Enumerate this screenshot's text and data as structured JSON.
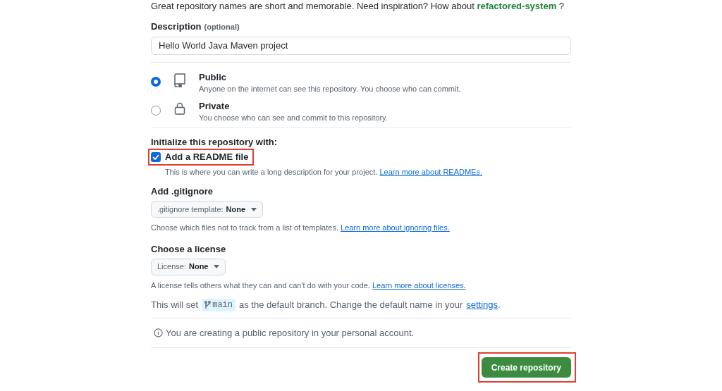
{
  "name_hint": {
    "text": "Great repository names are short and memorable. Need inspiration? How about",
    "suggestion": "refactored-system",
    "after": "?"
  },
  "description": {
    "label": "Description",
    "optional": "(optional)",
    "value": "Hello World Java Maven project"
  },
  "visibility": [
    {
      "kind": "repo",
      "label": "Public",
      "note": "Anyone on the internet can see this repository. You choose who can commit.",
      "selected": true
    },
    {
      "kind": "lock",
      "label": "Private",
      "note": "You choose who can see and commit to this repository.",
      "selected": false
    }
  ],
  "initialize": {
    "heading": "Initialize this repository with:",
    "readme": {
      "label": "Add a README file",
      "note": "This is where you can write a long description for your project.",
      "link": "Learn more about READMEs.",
      "checked": true,
      "highlighted": true
    }
  },
  "gitignore": {
    "heading": "Add .gitignore",
    "prefix": ".gitignore template:",
    "value": "None",
    "note": "Choose which files not to track from a list of templates.",
    "link": "Learn more about ignoring files."
  },
  "license": {
    "heading": "Choose a license",
    "prefix": "License:",
    "value": "None",
    "note": "A license tells others what they can and can't do with your code.",
    "link": "Learn more about licenses."
  },
  "branch": {
    "before": "This will set",
    "branch": "main",
    "middle": "as the default branch. Change the default name in your",
    "link": "settings",
    "after": "."
  },
  "info": "You are creating a public repository in your personal account.",
  "submit": {
    "label": "Create repository",
    "highlighted": true
  }
}
